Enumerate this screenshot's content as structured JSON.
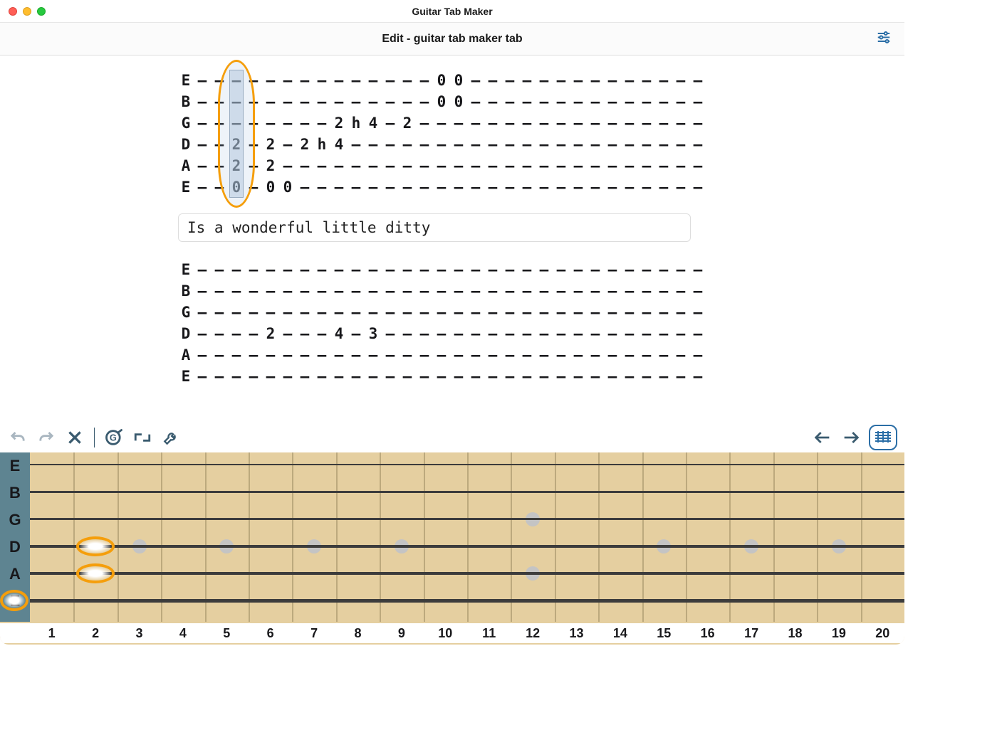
{
  "window": {
    "title": "Guitar Tab Maker",
    "subtitle": "Edit - guitar tab maker tab"
  },
  "string_labels": [
    "E",
    "B",
    "G",
    "D",
    "A",
    "E"
  ],
  "tab_blocks": [
    {
      "cols": 30,
      "selected_col": 2,
      "lyric": "Is a wonderful little ditty",
      "rows": [
        {
          "label": "E",
          "notes": {
            "14": "0",
            "15": "0"
          }
        },
        {
          "label": "B",
          "notes": {
            "14": "0",
            "15": "0"
          }
        },
        {
          "label": "G",
          "notes": {
            "8": "2",
            "9": "h",
            "10": "4",
            "12": "2"
          }
        },
        {
          "label": "D",
          "notes": {
            "2": "2",
            "4": "2",
            "6": "2",
            "7": "h",
            "8": "4"
          }
        },
        {
          "label": "A",
          "notes": {
            "2": "2",
            "4": "2"
          }
        },
        {
          "label": "E",
          "notes": {
            "2": "0",
            "4": "0",
            "5": "0"
          }
        }
      ]
    },
    {
      "cols": 30,
      "rows": [
        {
          "label": "E",
          "notes": {}
        },
        {
          "label": "B",
          "notes": {}
        },
        {
          "label": "G",
          "notes": {}
        },
        {
          "label": "D",
          "notes": {
            "4": "2",
            "8": "4",
            "10": "3"
          }
        },
        {
          "label": "A",
          "notes": {}
        },
        {
          "label": "E",
          "notes": {}
        }
      ]
    }
  ],
  "toolbar": {
    "undo": "undo",
    "redo": "redo",
    "delete": "delete",
    "chord": "chord-library",
    "crop": "crop",
    "tools": "tools",
    "prev": "prev-column",
    "next": "next-column",
    "view": "view-all"
  },
  "fretboard": {
    "string_labels": [
      "E",
      "B",
      "G",
      "D",
      "A",
      "E"
    ],
    "fret_count": 20,
    "inlay_frets": [
      3,
      5,
      7,
      9,
      12,
      12,
      15,
      17,
      19
    ],
    "fingers": [
      {
        "string": 3,
        "fret": 2
      },
      {
        "string": 4,
        "fret": 2
      },
      {
        "string": 5,
        "fret": 0
      }
    ],
    "fret_numbers": [
      1,
      2,
      3,
      4,
      5,
      6,
      7,
      8,
      9,
      10,
      11,
      12,
      13,
      14,
      15,
      16,
      17,
      18,
      19,
      20
    ]
  }
}
